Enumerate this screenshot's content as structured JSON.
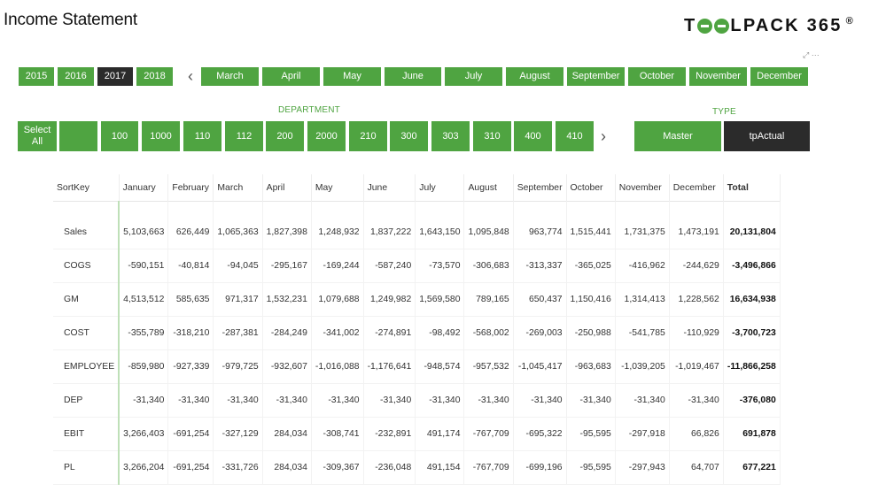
{
  "page": {
    "title": "Income Statement"
  },
  "logo": {
    "text_a": "T",
    "text_b": "LPACK 365",
    "reg": "®"
  },
  "visual_icons": {
    "expand": "⤢",
    "more": "···"
  },
  "years": [
    {
      "label": "2015",
      "selected": false
    },
    {
      "label": "2016",
      "selected": false
    },
    {
      "label": "2017",
      "selected": true
    },
    {
      "label": "2018",
      "selected": false
    }
  ],
  "months": {
    "prev_icon": "‹",
    "items": [
      "March",
      "April",
      "May",
      "June",
      "July",
      "August",
      "September",
      "October",
      "November",
      "December"
    ]
  },
  "department": {
    "title": "DEPARTMENT",
    "select_all": "Select All",
    "items": [
      "",
      "100",
      "1000",
      "110",
      "112",
      "200",
      "2000",
      "210",
      "300",
      "303",
      "310",
      "400",
      "410"
    ],
    "next_icon": "›"
  },
  "type": {
    "title": "TYPE",
    "items": [
      {
        "label": "Master",
        "selected": false
      },
      {
        "label": "tpActual",
        "selected": true
      }
    ]
  },
  "table": {
    "headers": [
      "SortKey",
      "January",
      "February",
      "March",
      "April",
      "May",
      "June",
      "July",
      "August",
      "September",
      "October",
      "November",
      "December",
      "Total"
    ],
    "rows": [
      {
        "key": "Sales",
        "values": [
          "5,103,663",
          "626,449",
          "1,065,363",
          "1,827,398",
          "1,248,932",
          "1,837,222",
          "1,643,150",
          "1,095,848",
          "963,774",
          "1,515,441",
          "1,731,375",
          "1,473,191"
        ],
        "total": "20,131,804"
      },
      {
        "key": "COGS",
        "values": [
          "-590,151",
          "-40,814",
          "-94,045",
          "-295,167",
          "-169,244",
          "-587,240",
          "-73,570",
          "-306,683",
          "-313,337",
          "-365,025",
          "-416,962",
          "-244,629"
        ],
        "total": "-3,496,866"
      },
      {
        "key": "GM",
        "values": [
          "4,513,512",
          "585,635",
          "971,317",
          "1,532,231",
          "1,079,688",
          "1,249,982",
          "1,569,580",
          "789,165",
          "650,437",
          "1,150,416",
          "1,314,413",
          "1,228,562"
        ],
        "total": "16,634,938"
      },
      {
        "key": "COST",
        "values": [
          "-355,789",
          "-318,210",
          "-287,381",
          "-284,249",
          "-341,002",
          "-274,891",
          "-98,492",
          "-568,002",
          "-269,003",
          "-250,988",
          "-541,785",
          "-110,929"
        ],
        "total": "-3,700,723"
      },
      {
        "key": "EMPLOYEE",
        "values": [
          "-859,980",
          "-927,339",
          "-979,725",
          "-932,607",
          "-1,016,088",
          "-1,176,641",
          "-948,574",
          "-957,532",
          "-1,045,417",
          "-963,683",
          "-1,039,205",
          "-1,019,467"
        ],
        "total": "-11,866,258"
      },
      {
        "key": "DEP",
        "values": [
          "-31,340",
          "-31,340",
          "-31,340",
          "-31,340",
          "-31,340",
          "-31,340",
          "-31,340",
          "-31,340",
          "-31,340",
          "-31,340",
          "-31,340",
          "-31,340"
        ],
        "total": "-376,080"
      },
      {
        "key": "EBIT",
        "values": [
          "3,266,403",
          "-691,254",
          "-327,129",
          "284,034",
          "-308,741",
          "-232,891",
          "491,174",
          "-767,709",
          "-695,322",
          "-95,595",
          "-297,918",
          "66,826"
        ],
        "total": "691,878"
      },
      {
        "key": "PL",
        "values": [
          "3,266,204",
          "-691,254",
          "-331,726",
          "284,034",
          "-309,367",
          "-236,048",
          "491,154",
          "-767,709",
          "-699,196",
          "-95,595",
          "-297,943",
          "64,707"
        ],
        "total": "677,221"
      }
    ]
  },
  "colors": {
    "accent": "#4fa441",
    "selected": "#2b2b2b"
  }
}
